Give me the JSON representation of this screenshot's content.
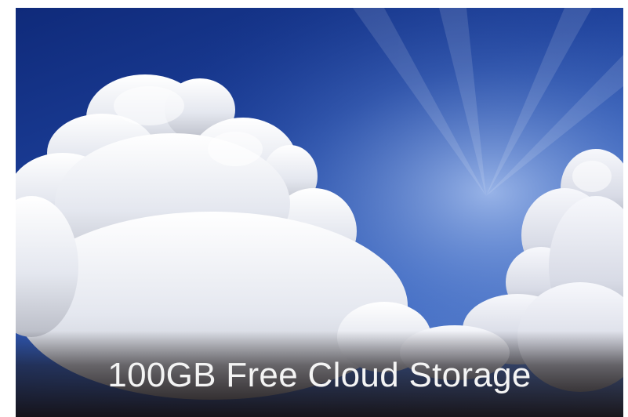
{
  "banner": {
    "caption": "100GB Free Cloud Storage",
    "scene": "cumulus-clouds-blue-sky"
  },
  "colors": {
    "sky_top": "#0f2a7a",
    "sky_light": "#6e92d6",
    "cloud": "#f2f3f7",
    "caption_text": "#f4f4f4",
    "band": "#120c0c"
  }
}
